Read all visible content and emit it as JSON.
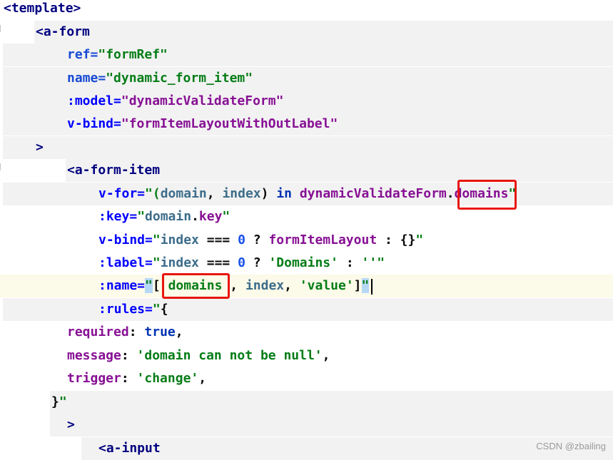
{
  "editor": {
    "colors": {
      "line_bg": "#f2f2f2",
      "highlight_box": "#e8150e",
      "quote_highlight": "#b5d8f6",
      "current_line": "#fcfae8"
    },
    "lines": [
      {
        "t1": "<template>"
      },
      {
        "t1": "<a-form"
      },
      {
        "k": "ref=",
        "q": "\"formRef\""
      },
      {
        "k": "name=",
        "q": "\"dynamic_form_item\""
      },
      {
        "k": ":model=",
        "q": "\"dynamicValidateForm\""
      },
      {
        "k": "v-bind=",
        "q": "\"formItemLayoutWithOutLabel\""
      },
      {
        "t1": ">"
      },
      {
        "t1": "<a-form-item"
      },
      {
        "k": "v-for=",
        "q1": "\"(",
        "v1": "domain",
        "p1": ", ",
        "v2": "index",
        "p2": ") ",
        "kw": "in",
        "p3": " ",
        "w": "dynamicValidateForm",
        "p4": ".",
        "w2": "domains",
        "q2": "\""
      },
      {
        "k": ":key=",
        "q1": "\"",
        "v1": "domain",
        "p1": ".",
        "w": "key",
        "q2": "\""
      },
      {
        "k": "v-bind=",
        "q1": "\"",
        "v1": "index",
        "p1": " === ",
        "n": "0",
        "p2": " ? ",
        "w": "formItemLayout",
        "p3": " : {}",
        "q2": "\""
      },
      {
        "k": ":label=",
        "q1": "\"",
        "v1": "index",
        "p1": " === ",
        "n": "0",
        "p2": " ? ",
        "s": "'Domains'",
        "p3": " : ",
        "s2": "''",
        "q2": "\""
      },
      {
        "k": ":name=",
        "q1": "\"",
        "p1": "[ ",
        "w": "domains",
        "p2": " , ",
        "v1": "index",
        "p3": ", ",
        "s": "'value'",
        "p4": "]",
        "q2": "\""
      },
      {
        "k": ":rules=",
        "q1": "\"",
        "p1": "{"
      },
      {
        "w": "required",
        "p1": ": ",
        "kw": "true",
        "p2": ","
      },
      {
        "w": "message",
        "p1": ": ",
        "s": "'domain can not be null'",
        "p2": ","
      },
      {
        "w": "trigger",
        "p1": ": ",
        "s": "'change'",
        "p2": ","
      },
      {
        "p1": "}",
        "q": "\""
      },
      {
        "t1": ">"
      },
      {
        "t1": "<a-input"
      }
    ]
  },
  "watermark": "CSDN @zbailing"
}
